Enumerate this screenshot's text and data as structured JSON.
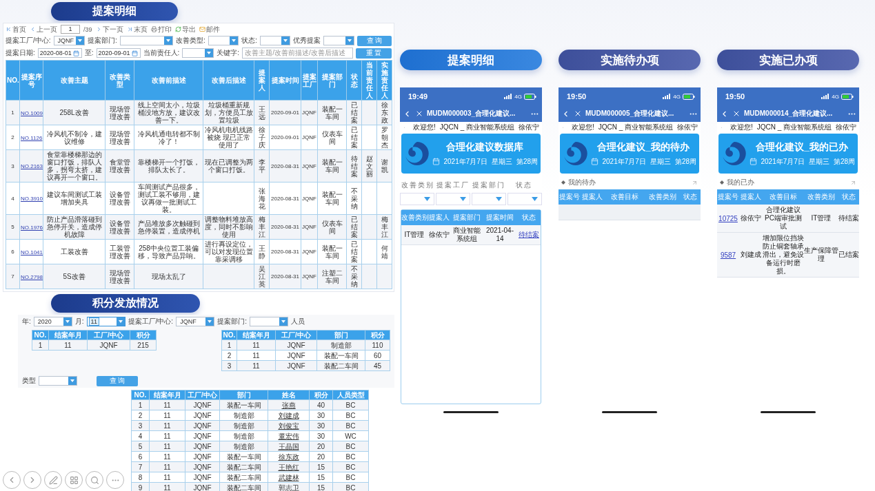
{
  "detail": {
    "title": "提案明细",
    "pager": [
      {
        "kind": "first",
        "label": "首页"
      },
      {
        "kind": "prev",
        "label": "上一页"
      },
      {
        "kind": "page",
        "value": "1",
        "total": "/39"
      },
      {
        "kind": "next",
        "label": "下一页"
      },
      {
        "kind": "last",
        "label": "末页"
      },
      {
        "kind": "print",
        "label": "打印"
      },
      {
        "kind": "export",
        "label": "导出"
      },
      {
        "kind": "mail",
        "label": "邮件"
      }
    ],
    "filters": [
      [
        {
          "kind": "select",
          "label": "提案工厂/中心:",
          "value": "JQNF"
        },
        {
          "kind": "select",
          "label": "提案部门:"
        },
        {
          "kind": "select",
          "label": "改善类型:"
        },
        {
          "kind": "select",
          "label": "状态:"
        },
        {
          "kind": "select",
          "label": "优秀提案"
        },
        {
          "kind": "button",
          "label": "查 询"
        }
      ],
      [
        {
          "kind": "date",
          "label": "提案日期:",
          "value": "2020-08-01"
        },
        {
          "kind": "date",
          "label": "至:",
          "value": "2020-09-01"
        },
        {
          "kind": "select",
          "label": "当前责任人:"
        },
        {
          "kind": "text",
          "label": "关键字:",
          "placeholder": "改善主题/改善前描述/改善后描述"
        },
        {
          "kind": "button",
          "label": "重 置"
        }
      ]
    ],
    "table": {
      "columns": [
        {
          "label": "NO.",
          "kind": "code"
        },
        {
          "label": "提案序号",
          "kind": "link"
        },
        {
          "label": "改善主题",
          "kind": "text"
        },
        {
          "label": "改善类型",
          "kind": "text"
        },
        {
          "label": "改善前描述",
          "kind": "text"
        },
        {
          "label": "改善后描述",
          "kind": "text"
        },
        {
          "label": "提案人",
          "kind": "text"
        },
        {
          "label": "提案时间",
          "kind": "code"
        },
        {
          "label": "提案工厂",
          "kind": "code"
        },
        {
          "label": "提案部门",
          "kind": "text"
        },
        {
          "label": "状态",
          "kind": "text"
        },
        {
          "label": "当前责任人",
          "kind": "text"
        },
        {
          "label": "实施责任人",
          "kind": "text"
        }
      ],
      "rows": [
        [
          "1",
          "NO.1009",
          "258L改善",
          "现场管理改善",
          "线上空间太小，垃圾桶没地方放，建议改善一下。",
          "垃圾桶重新规划，方便员工放置垃圾",
          "王远",
          "2020-09-01",
          "JQNF",
          "装配一车间",
          "已结案",
          "",
          "徐东政"
        ],
        [
          "2",
          "NO.1126",
          "冷风机不制冷，建议维修",
          "现场管理改善",
          "冷风机通电转都不制冷了！",
          "冷风机电机线路被烧 现已正常使用了",
          "徐子庆",
          "2020-09-01",
          "JQNF",
          "仪表车间",
          "已结案",
          "",
          "罗朝杰"
        ],
        [
          "3",
          "NO.2163",
          "食堂靠楼梯那边的窗口打饭，排队人多，拐弯太挤，建议再开一个窗口。",
          "食堂管理改善",
          "靠楼梯开一个打饭，排队太长了。",
          "现在已调整为两个窗口打饭。",
          "李平",
          "2020-08-31",
          "JQNF",
          "装配一车间",
          "待结案",
          "赵文丽",
          "谢凯"
        ],
        [
          "4",
          "NO.3910",
          "建议车间测试工装增加夹具",
          "设备管理改善",
          "车间测试产品很多，测试工装不够用，建议再做一批测试工装。",
          "",
          "张海花",
          "2020-08-31",
          "JQNF",
          "装配一车间",
          "不采纳",
          "",
          ""
        ],
        [
          "5",
          "NO.1976",
          "防止产品滑落碰到急停开关，造成停机故障",
          "设备管理改善",
          "产品堆放多次触碰到急停装置，造成停机",
          "调整物料堆放高度，同时不影响使用",
          "梅丰江",
          "2020-08-31",
          "JQNF",
          "仪表车间",
          "已结案",
          "",
          "梅丰江"
        ],
        [
          "6",
          "NO.1041",
          "工装改善",
          "工装管理改善",
          "258中央位置工装偏移，导致产品异响。",
          "进行再设定位，可以对发现位置靠采调移",
          "王静",
          "2020-08-31",
          "JQNF",
          "装配一车间",
          "已结案",
          "",
          "何靖"
        ],
        [
          "7",
          "NO.2798",
          "5S改善",
          "现场管理改善",
          "现场太乱了",
          "",
          "吴江英",
          "2020-08-31",
          "JQNF",
          "注塑二车间",
          "不采纳",
          "",
          ""
        ]
      ]
    }
  },
  "points": {
    "title": "积分发放情况",
    "filters": [
      {
        "kind": "select",
        "label": "年:",
        "value": "2020",
        "focused": false
      },
      {
        "kind": "select",
        "label": "月:",
        "value": "11",
        "focused": true
      },
      {
        "kind": "select",
        "label": "提案工厂/中心:",
        "value": "JQNF",
        "focused": false
      },
      {
        "kind": "select",
        "label": "提案部门:",
        "focused": false
      },
      {
        "kind": "label",
        "label": "人员"
      }
    ],
    "summary_tables": [
      {
        "columns": [
          {
            "label": "NO.",
            "kind": "text"
          },
          {
            "label": "结案年月",
            "kind": "text"
          },
          {
            "label": "工厂/中心",
            "kind": "text"
          },
          {
            "label": "积分",
            "kind": "text"
          }
        ],
        "rows": [
          [
            "1",
            "11",
            "JQNF",
            "215"
          ]
        ]
      },
      {
        "columns": [
          {
            "label": "NO.",
            "kind": "text"
          },
          {
            "label": "结案年月",
            "kind": "text"
          },
          {
            "label": "工厂/中心",
            "kind": "text"
          },
          {
            "label": "部门",
            "kind": "text"
          },
          {
            "label": "积分",
            "kind": "text"
          }
        ],
        "rows": [
          [
            "1",
            "11",
            "JQNF",
            "制造部",
            "110"
          ],
          [
            "2",
            "11",
            "JQNF",
            "装配一车间",
            "60"
          ],
          [
            "3",
            "11",
            "JQNF",
            "装配二车间",
            "45"
          ]
        ]
      }
    ],
    "type_filter": {
      "label": "类型",
      "button": "查 询"
    },
    "table": {
      "columns": [
        {
          "label": "NO.",
          "kind": "text"
        },
        {
          "label": "结案年月",
          "kind": "text"
        },
        {
          "label": "工厂/中心",
          "kind": "text"
        },
        {
          "label": "部门",
          "kind": "text"
        },
        {
          "label": "姓名",
          "kind": "link"
        },
        {
          "label": "积分",
          "kind": "text"
        },
        {
          "label": "人员类型",
          "kind": "text"
        }
      ],
      "rows": [
        [
          "1",
          "11",
          "JQNF",
          "装配一车间",
          "张燕",
          "40",
          "BC"
        ],
        [
          "2",
          "11",
          "JQNF",
          "制造部",
          "刘建成",
          "30",
          "BC"
        ],
        [
          "3",
          "11",
          "JQNF",
          "制造部",
          "刘俊宝",
          "30",
          "BC"
        ],
        [
          "4",
          "11",
          "JQNF",
          "制造部",
          "董宏伟",
          "30",
          "WC"
        ],
        [
          "5",
          "11",
          "JQNF",
          "制造部",
          "王晶国",
          "20",
          "BC"
        ],
        [
          "6",
          "11",
          "JQNF",
          "装配一车间",
          "徐东政",
          "20",
          "BC"
        ],
        [
          "7",
          "11",
          "JQNF",
          "装配二车间",
          "王艳红",
          "15",
          "BC"
        ],
        [
          "8",
          "11",
          "JQNF",
          "装配二车间",
          "武建林",
          "15",
          "BC"
        ],
        [
          "9",
          "11",
          "JQNF",
          "装配二车间",
          "郭志卫",
          "15",
          "BC"
        ]
      ]
    }
  },
  "mobile": {
    "tabs": [
      {
        "label": "提案明细",
        "selected": true
      },
      {
        "label": "实施待办项",
        "selected": false
      },
      {
        "label": "实施已办项",
        "selected": false
      }
    ],
    "phones": [
      {
        "kind": "filters",
        "time": "19:49",
        "network": "4G",
        "title": "MUDM000003_合理化建议...",
        "welcome": [
          "欢迎您!",
          "JQCN _ 商业智能系统组",
          "徐依宁"
        ],
        "banner_title": "合理化建议数据库",
        "date": "2021年7月7日",
        "weekday": "星期三",
        "week": "第28周",
        "filters": [
          "改善类别",
          "提案工厂",
          "提案部门",
          "状态"
        ],
        "table": {
          "columns": [
            {
              "label": "改善类别",
              "kind": "text"
            },
            {
              "label": "提案人",
              "kind": "text"
            },
            {
              "label": "提案部门",
              "kind": "text"
            },
            {
              "label": "提案时间",
              "kind": "text"
            },
            {
              "label": "状态",
              "kind": "link"
            }
          ],
          "rows": [
            [
              "IT管理",
              "徐依宁",
              "商业智能系统组",
              "2021-04-14",
              "待结案"
            ]
          ]
        }
      },
      {
        "kind": "list",
        "time": "19:50",
        "network": "4G",
        "title": "MUDM000005_合理化建议...",
        "welcome": [
          "欢迎您!",
          "JQCN _ 商业智能系统组",
          "徐依宁"
        ],
        "banner_title": "合理化建议_我的待办",
        "date": "2021年7月7日",
        "weekday": "星期三",
        "week": "第28周",
        "section": "我的待办",
        "table": {
          "columns": [
            "提案号",
            "提案人",
            "改善目标",
            "改善类别",
            "状态"
          ]
        }
      },
      {
        "kind": "list",
        "time": "19:50",
        "network": "4G",
        "title": "MUDM000014_合理化建议...",
        "welcome": [
          "欢迎您!",
          "JQCN _ 商业智能系统组",
          "徐依宁"
        ],
        "banner_title": "合理化建议_我的已办",
        "date": "2021年7月7日",
        "weekday": "星期三",
        "week": "第28周",
        "section": "我的已办",
        "table": {
          "columns": [
            {
              "label": "提案号",
              "kind": "link"
            },
            {
              "label": "提案人",
              "kind": "text"
            },
            {
              "label": "改善目标",
              "kind": "text"
            },
            {
              "label": "改善类别",
              "kind": "text"
            },
            {
              "label": "状态",
              "kind": "text"
            }
          ],
          "rows": [
            [
              "10725",
              "徐依宁",
              "合理化建议PC端审批测试",
              "IT管理",
              "待结案"
            ],
            [
              "9587",
              "刘建成",
              "增加限位挡块防止铜套轴承滑出，避免设备运行时磨损。",
              "生产保障管理",
              "已结案"
            ]
          ]
        }
      }
    ]
  }
}
